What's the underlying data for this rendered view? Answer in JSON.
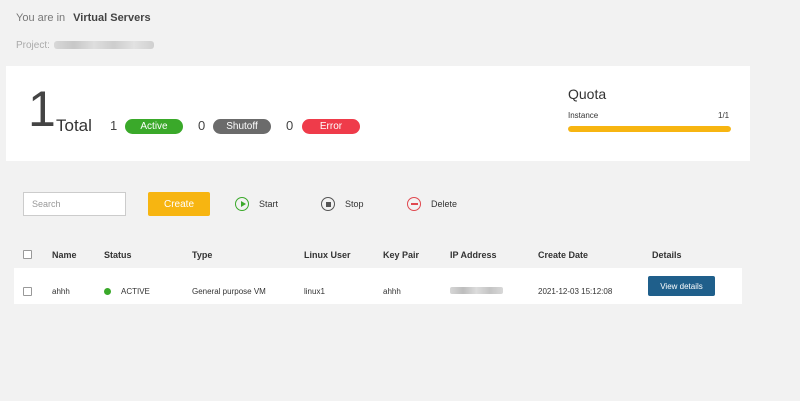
{
  "breadcrumb": {
    "prefix": "You are in",
    "current": "Virtual Servers"
  },
  "project": {
    "label": "Project:"
  },
  "summary": {
    "total_count": "1",
    "total_label": "Total",
    "active_count": "1",
    "active_label": "Active",
    "shutoff_count": "0",
    "shutoff_label": "Shutoff",
    "error_count": "0",
    "error_label": "Error"
  },
  "quota": {
    "title": "Quota",
    "instance_label": "Instance",
    "instance_value": "1/1",
    "instance_fraction": 1.0,
    "bar_color": "#f7b511"
  },
  "toolbar": {
    "search_placeholder": "Search",
    "create_label": "Create",
    "start_label": "Start",
    "stop_label": "Stop",
    "delete_label": "Delete"
  },
  "table": {
    "columns": [
      "Name",
      "Status",
      "Type",
      "Linux User",
      "Key Pair",
      "IP Address",
      "Create Date",
      "Details"
    ],
    "rows": [
      {
        "name": "ahhh",
        "status": "ACTIVE",
        "type": "General purpose VM",
        "linux_user": "linux1",
        "key_pair": "ahhh",
        "create_date": "2021-12-03 15:12:08",
        "details_label": "View details"
      }
    ]
  },
  "colors": {
    "accent": "#f7b511",
    "active": "#3aa92a",
    "shutoff": "#6b6b6b",
    "error": "#ef3b4a",
    "details_button": "#1f5f8b"
  }
}
